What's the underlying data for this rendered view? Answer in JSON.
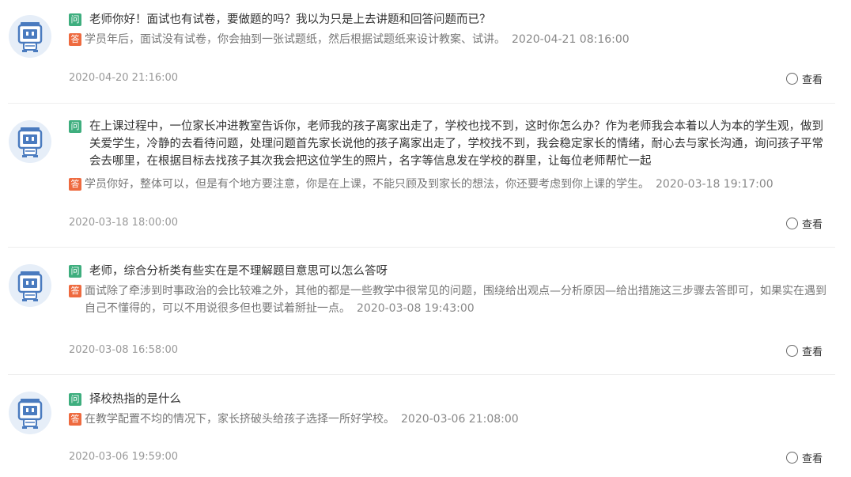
{
  "items": [
    {
      "badge_q": "问",
      "question": "老师你好！面试也有试卷，要做题的吗？我以为只是上去讲题和回答问题而已？",
      "badge_a": "答",
      "answer": "学员年后，面试没有试卷，你会抽到一张试题纸，然后根据试题纸来设计教案、试讲。",
      "answer_time": "2020-04-21 08:16:00",
      "question_time": "2020-04-20 21:16:00",
      "view_label": "查看"
    },
    {
      "badge_q": "问",
      "question": "在上课过程中，一位家长冲进教室告诉你，老师我的孩子离家出走了，学校也找不到，这时你怎么办？作为老师我会本着以人为本的学生观，做到关爱学生，冷静的去看待问题，处理问题首先家长说他的孩子离家出走了，学校找不到，我会稳定家长的情绪，耐心去与家长沟通，询问孩子平常会去哪里，在根据目标去找孩子其次我会把这位学生的照片，名字等信息发在学校的群里，让每位老师帮忙一起",
      "badge_a": "答",
      "answer": "学员你好，整体可以，但是有个地方要注意，你是在上课，不能只顾及到家长的想法，你还要考虑到你上课的学生。",
      "answer_time": "2020-03-18 19:17:00",
      "question_time": "2020-03-18 18:00:00",
      "view_label": "查看"
    },
    {
      "badge_q": "问",
      "question": "老师，综合分析类有些实在是不理解题目意思可以怎么答呀",
      "badge_a": "答",
      "answer": "面试除了牵涉到时事政治的会比较难之外，其他的都是一些教学中很常见的问题，围绕给出观点—分析原因—给出措施这三步骤去答即可，如果实在遇到自己不懂得的，可以不用说很多但也要试着掰扯一点。",
      "answer_time": "2020-03-08 19:43:00",
      "question_time": "2020-03-08 16:58:00",
      "view_label": "查看"
    },
    {
      "badge_q": "问",
      "question": "择校热指的是什么",
      "badge_a": "答",
      "answer": "在教学配置不均的情况下，家长挤破头给孩子选择一所好学校。",
      "answer_time": "2020-03-06 21:08:00",
      "question_time": "2020-03-06 19:59:00",
      "view_label": "查看"
    }
  ],
  "colors": {
    "badge_q": "#3eae7e",
    "badge_a": "#ee6a3f",
    "avatar_bg": "#e6eef8",
    "avatar_robot": "#4a7bbf"
  }
}
